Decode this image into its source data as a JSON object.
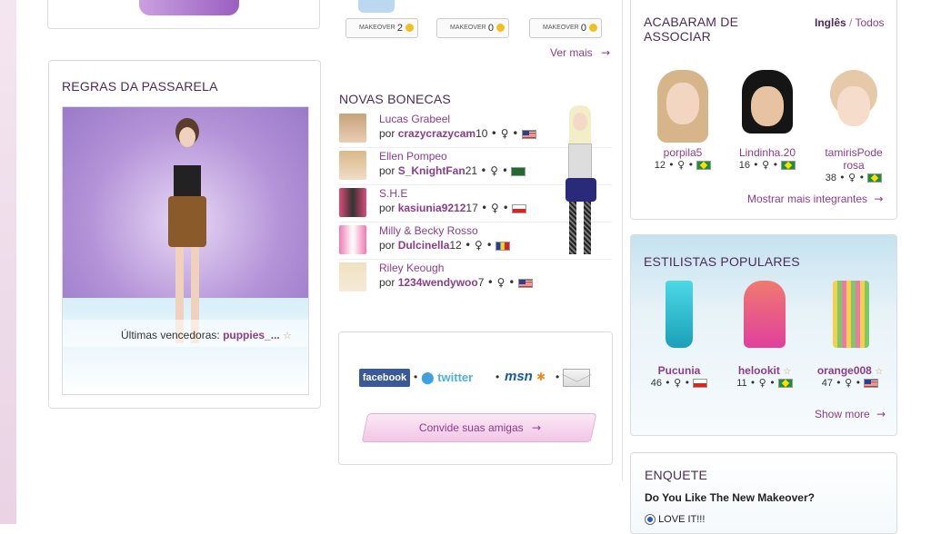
{
  "runway": {
    "title": "REGRAS DA PASSARELA",
    "winners_label": "Últimas vencedoras:",
    "winner_name": "puppies_..."
  },
  "makeover": {
    "items": [
      {
        "label": "MAKEOVER",
        "count": "2"
      },
      {
        "label": "MAKEOVER",
        "count": "0"
      },
      {
        "label": "MAKEOVER",
        "count": "0"
      }
    ],
    "see_more": "Ver mais"
  },
  "new_dolls": {
    "title": "NOVAS BONECAS",
    "by_label": "por",
    "items": [
      {
        "name": "Lucas Grabeel",
        "user": "crazycrazycam",
        "age": "10",
        "flag": "us"
      },
      {
        "name": "Ellen Pompeo",
        "user": "S_KnightFan",
        "age": "21",
        "flag": "sa"
      },
      {
        "name": "S.H.E",
        "user": "kasiunia9212",
        "age": "17",
        "flag": "pl"
      },
      {
        "name": "Milly & Becky Rosso",
        "user": "Dulcinella",
        "age": "12",
        "flag": "ro"
      },
      {
        "name": "Riley Keough",
        "user": "1234wendywoo",
        "age": "7",
        "flag": "us"
      }
    ]
  },
  "share": {
    "facebook": "facebook",
    "twitter": "twitter",
    "msn": "msn",
    "invite": "Convide suas amigas"
  },
  "members": {
    "title": "ACABARAM DE ASSOCIAR",
    "filter_english": "Inglês",
    "filter_sep": "/",
    "filter_all": "Todos",
    "items": [
      {
        "user": "porpila5",
        "age": "12",
        "flag": "br"
      },
      {
        "user": "Lindinha.20",
        "age": "16",
        "flag": "br"
      },
      {
        "user": "tamirisPoderosa",
        "age": "38",
        "flag": "br"
      }
    ],
    "show_more": "Mostrar mais integrantes"
  },
  "stylists": {
    "title": "ESTILISTAS POPULARES",
    "items": [
      {
        "user": "Pucunia",
        "age": "46",
        "flag": "pl"
      },
      {
        "user": "helookit",
        "age": "11",
        "flag": "br"
      },
      {
        "user": "orange008",
        "age": "47",
        "flag": "us"
      }
    ],
    "show_more": "Show more"
  },
  "poll": {
    "title": "ENQUETE",
    "question": "Do You Like The New Makeover?",
    "option1": "LOVE IT!!!"
  },
  "colors": {
    "accent": "#8c3d8c",
    "title": "#4a2c5a"
  }
}
